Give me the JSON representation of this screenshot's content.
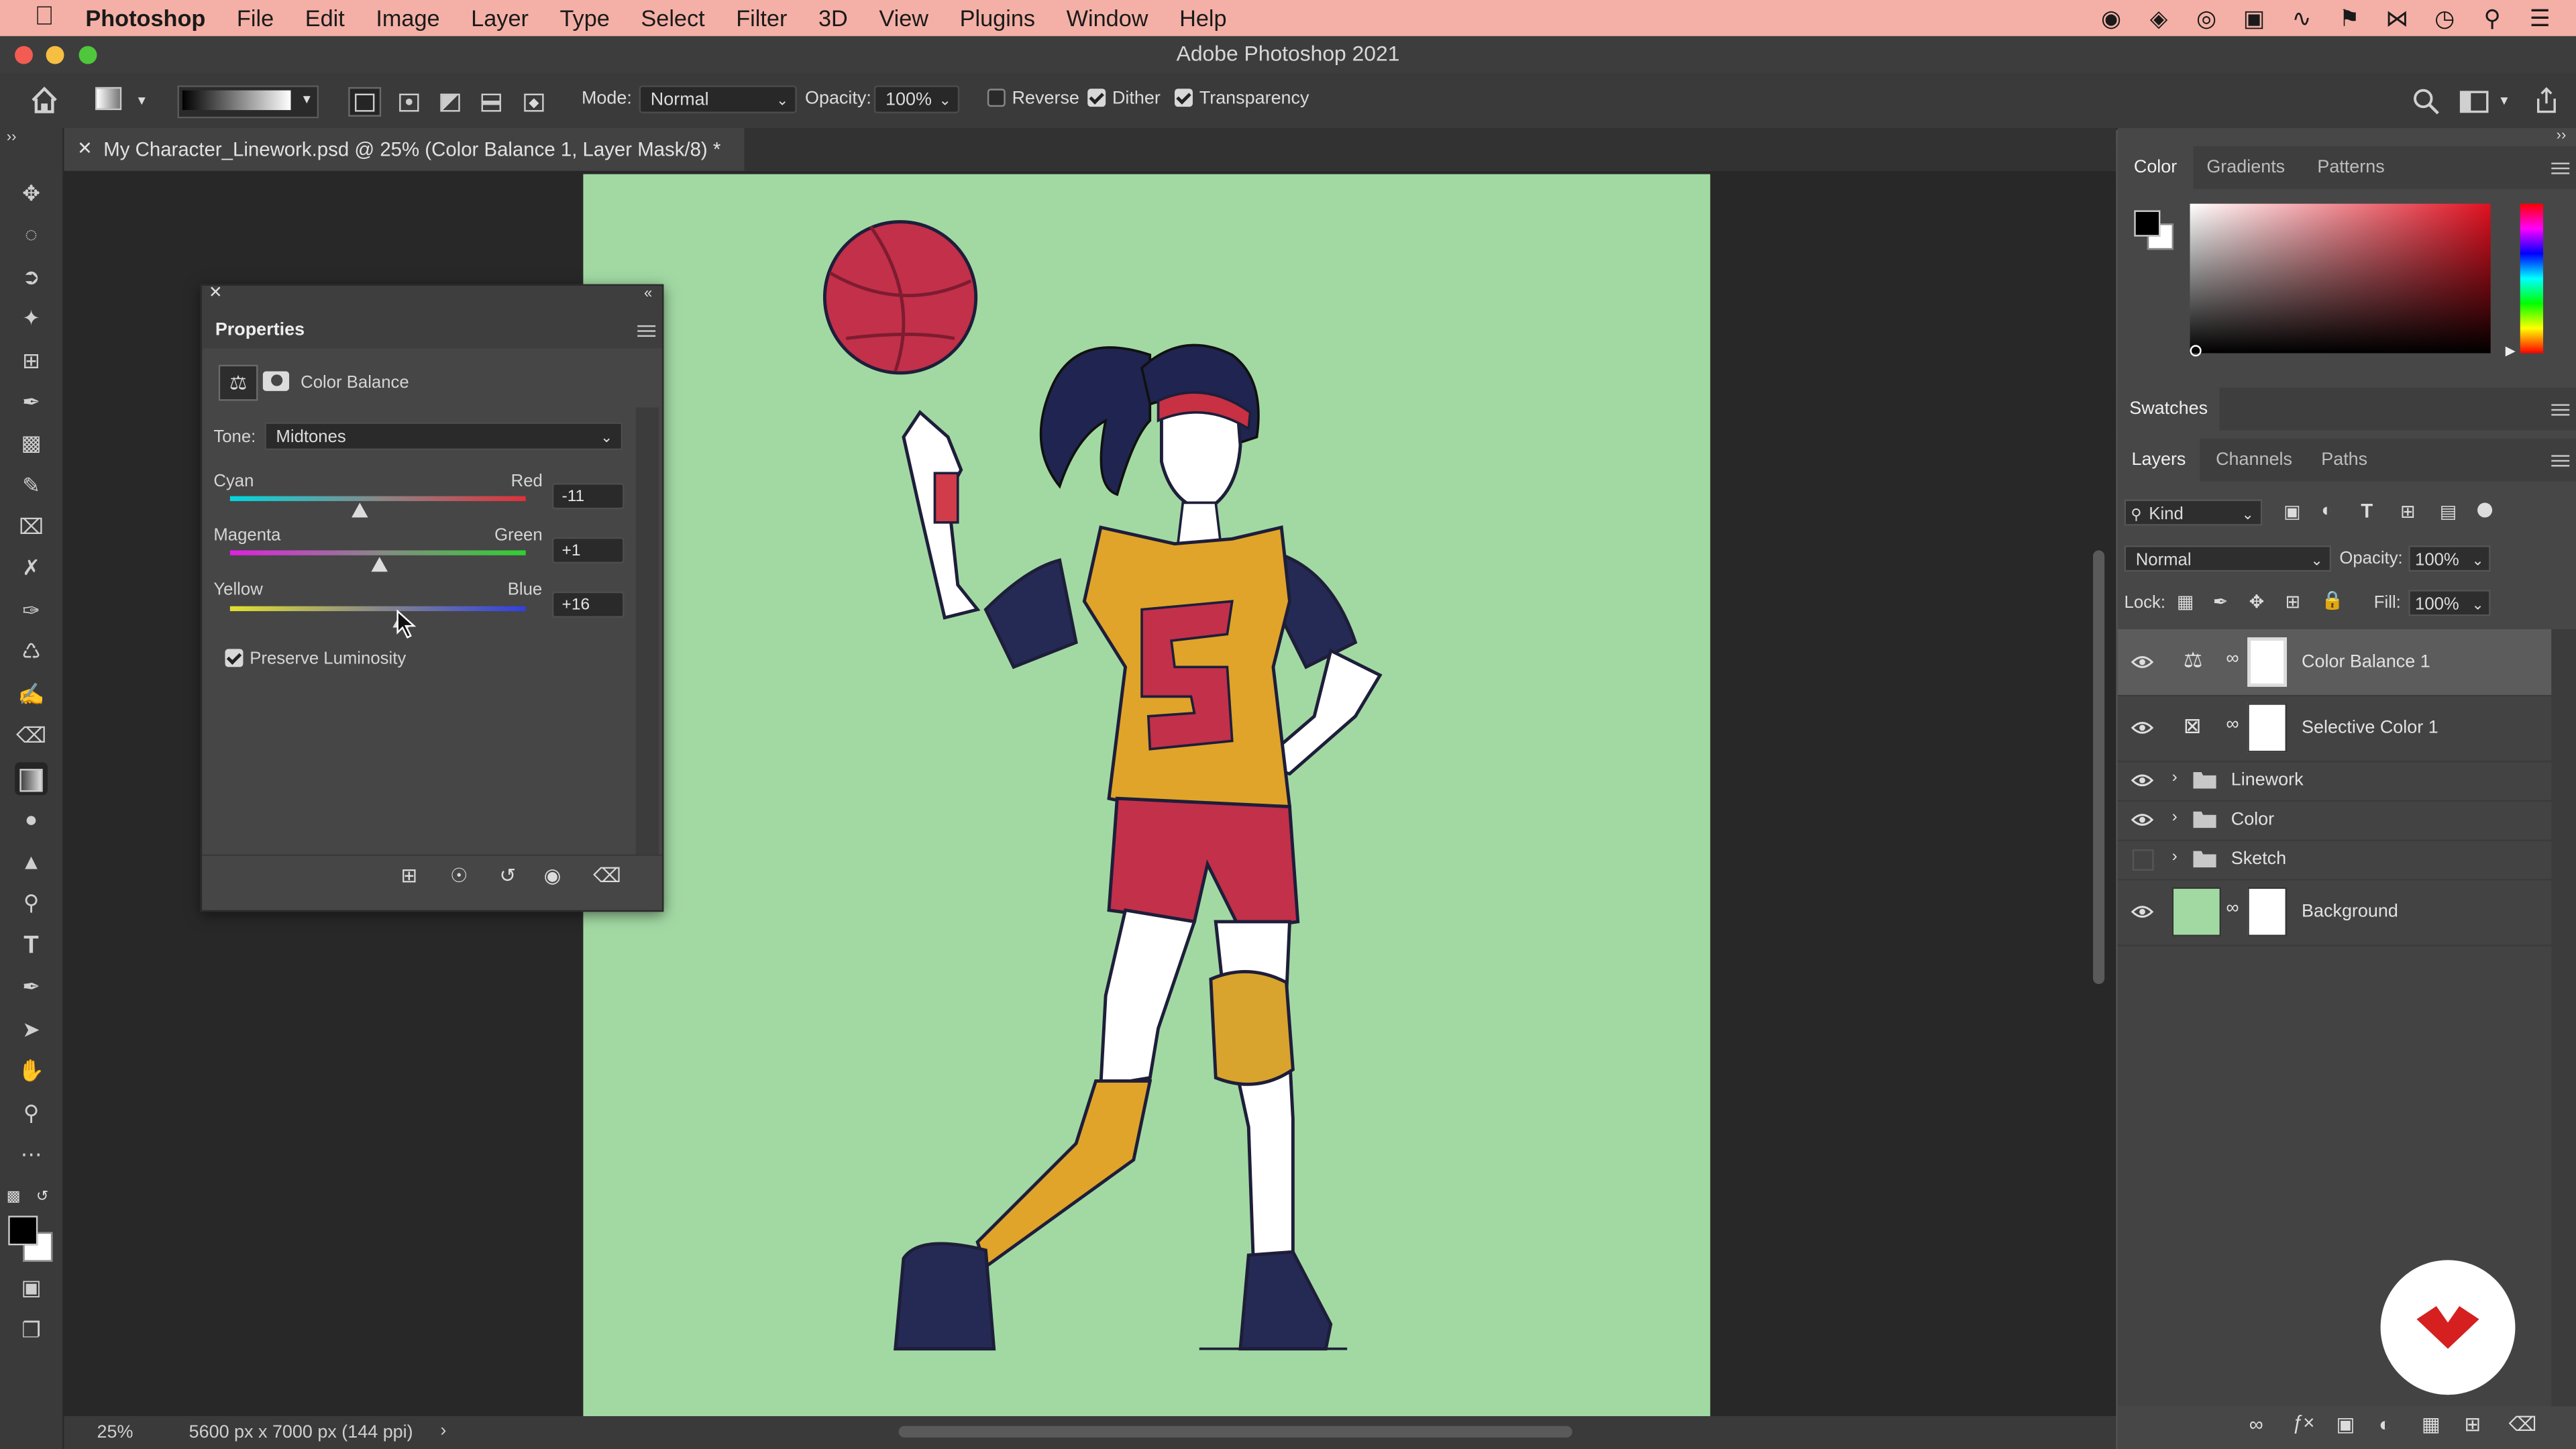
{
  "menubar": {
    "app": "Photoshop",
    "items": [
      "File",
      "Edit",
      "Image",
      "Layer",
      "Type",
      "Select",
      "Filter",
      "3D",
      "View",
      "Plugins",
      "Window",
      "Help"
    ]
  },
  "window": {
    "title": "Adobe Photoshop 2021"
  },
  "options": {
    "mode_label": "Mode:",
    "mode_value": "Normal",
    "opacity_label": "Opacity:",
    "opacity_value": "100%",
    "reverse_label": "Reverse",
    "dither_label": "Dither",
    "transparency_label": "Transparency"
  },
  "document": {
    "tab_title": "My Character_Linework.psd @ 25% (Color Balance 1, Layer Mask/8) *",
    "zoom": "25%",
    "doc_info": "5600 px x 7000 px (144 ppi)",
    "background_color": "#a2d9a3"
  },
  "properties": {
    "title": "Properties",
    "adjustment_name": "Color Balance",
    "tone_label": "Tone:",
    "tone_value": "Midtones",
    "sliders": [
      {
        "left": "Cyan",
        "right": "Red",
        "value": "-11",
        "position": 0.44
      },
      {
        "left": "Magenta",
        "right": "Green",
        "value": "+1",
        "position": 0.505
      },
      {
        "left": "Yellow",
        "right": "Blue",
        "value": "+16",
        "position": 0.58
      }
    ],
    "preserve_label": "Preserve Luminosity"
  },
  "panels": {
    "color_tabs": [
      "Color",
      "Gradients",
      "Patterns"
    ],
    "swatches_title": "Swatches",
    "layers_tabs": [
      "Layers",
      "Channels",
      "Paths"
    ],
    "filter_kind": "Kind",
    "blend_mode": "Normal",
    "opacity_label": "Opacity:",
    "opacity_value": "100%",
    "lock_label": "Lock:",
    "fill_label": "Fill:",
    "fill_value": "100%"
  },
  "layers": [
    {
      "name": "Color Balance 1",
      "type": "adjustment",
      "visible": true,
      "selected": true
    },
    {
      "name": "Selective Color 1",
      "type": "adjustment",
      "visible": true,
      "selected": false
    },
    {
      "name": "Linework",
      "type": "group",
      "visible": true,
      "selected": false
    },
    {
      "name": "Color",
      "type": "group",
      "visible": true,
      "selected": false
    },
    {
      "name": "Sketch",
      "type": "group",
      "visible": false,
      "selected": false
    },
    {
      "name": "Background",
      "type": "image",
      "visible": true,
      "selected": false
    }
  ],
  "colors": {
    "menubar_bg": "#f4b0a6",
    "accent_logo": "#d61f1f",
    "jersey": "#e0a42a",
    "ball": "#c2304a",
    "navy": "#252a55"
  }
}
